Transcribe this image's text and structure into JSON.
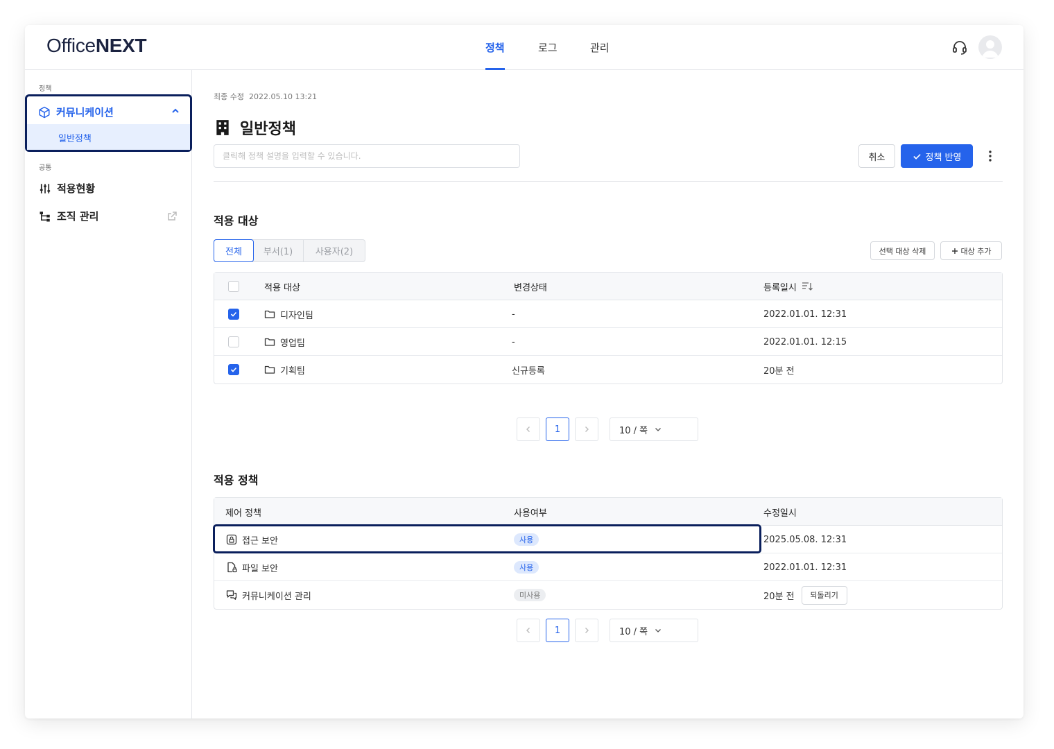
{
  "app": {
    "logo_light": "Office",
    "logo_bold": "NEXT"
  },
  "nav": {
    "tabs": [
      {
        "label": "정책",
        "active": true
      },
      {
        "label": "로그",
        "active": false
      },
      {
        "label": "관리",
        "active": false
      }
    ],
    "icons": [
      "headset-icon",
      "user-avatar-icon"
    ]
  },
  "sidebar": {
    "section_policy": "정책",
    "group_label": "커뮤니케이션",
    "group_icon": "cube-icon",
    "sub_item": "일반정책",
    "section_common": "공통",
    "items": [
      {
        "label": "적용현황",
        "icon": "sliders-icon"
      },
      {
        "label": "조직 관리",
        "icon": "org-chart-icon",
        "external": true
      }
    ]
  },
  "main": {
    "last_modified_label": "최종 수정",
    "last_modified_value": "2022.05.10 13:21",
    "title": "일반정책",
    "title_icon": "building-icon",
    "description_placeholder": "클릭해 정책 설명을 입력할 수 있습니다.",
    "cancel_label": "취소",
    "apply_label": "정책 반영",
    "targets": {
      "title": "적용 대상",
      "segments": [
        "전체",
        "부서(1)",
        "사용자(2)"
      ],
      "active_segment": 0,
      "delete_selected_label": "선택 대상 삭제",
      "add_target_label": "대상 추가",
      "columns": [
        "적용 대상",
        "변경상태",
        "등록일시"
      ],
      "rows": [
        {
          "name": "디자인팀",
          "status": "-",
          "date": "2022.01.01. 12:31",
          "checked": true
        },
        {
          "name": "영업팀",
          "status": "-",
          "date": "2022.01.01. 12:15",
          "checked": false
        },
        {
          "name": "기획팀",
          "status": "신규등록",
          "date": "20분 전",
          "checked": true
        }
      ],
      "pager": {
        "current": "1",
        "page_size": "10 / 쪽"
      }
    },
    "policies": {
      "title": "적용 정책",
      "columns": [
        "제어 정책",
        "사용여부",
        "수정일시"
      ],
      "rows": [
        {
          "name": "접근 보안",
          "icon": "lock-icon",
          "usage": "사용",
          "usage_on": true,
          "date": "2025.05.08. 12:31"
        },
        {
          "name": "파일 보안",
          "icon": "file-lock-icon",
          "usage": "사용",
          "usage_on": true,
          "date": "2022.01.01. 12:31"
        },
        {
          "name": "커뮤니케이션 관리",
          "icon": "chat-icon",
          "usage": "미사용",
          "usage_on": false,
          "date": "20분 전",
          "revert_label": "되돌리기"
        }
      ],
      "pager": {
        "current": "1",
        "page_size": "10 / 쪽"
      }
    }
  },
  "colors": {
    "accent": "#2563eb",
    "highlight_border": "#0a1f5c",
    "selected_bg": "#e7effe"
  }
}
